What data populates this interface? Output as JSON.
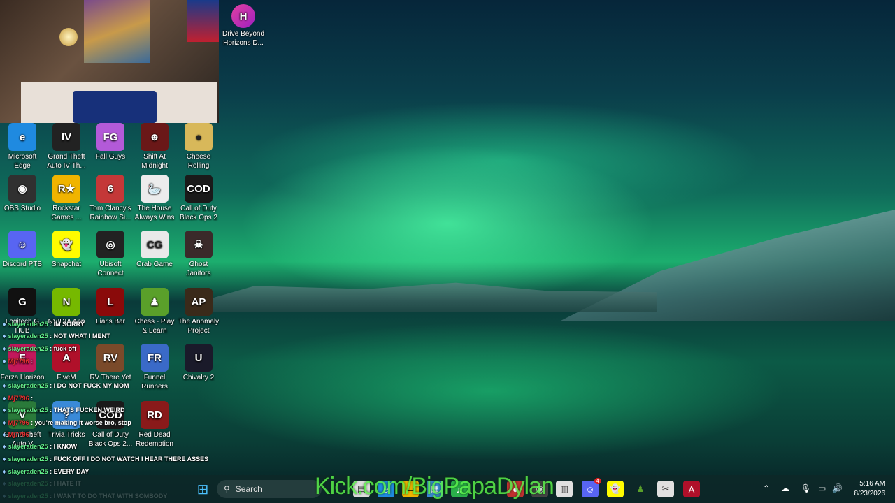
{
  "webcam": {
    "label": "streamer webcam"
  },
  "top_icon": {
    "label": "Drive Beyond Horizons D..."
  },
  "desktop_icons": [
    {
      "label": "Microsoft Edge",
      "glyph": "e",
      "color": "#1f8ae0"
    },
    {
      "label": "Grand Theft Auto IV Th...",
      "glyph": "IV",
      "color": "#222"
    },
    {
      "label": "Fall Guys",
      "glyph": "FG",
      "color": "#b35ad8"
    },
    {
      "label": "Shift At Midnight",
      "glyph": "☻",
      "color": "#6a1818"
    },
    {
      "label": "Cheese Rolling",
      "glyph": "●",
      "color": "#d8b85a"
    },
    {
      "label": "OBS Studio",
      "glyph": "◉",
      "color": "#303030"
    },
    {
      "label": "Rockstar Games ...",
      "glyph": "R★",
      "color": "#f0b400"
    },
    {
      "label": "Tom Clancy's Rainbow Si...",
      "glyph": "6",
      "color": "#c43838"
    },
    {
      "label": "The House Always Wins",
      "glyph": "🦢",
      "color": "#ececec"
    },
    {
      "label": "Call of Duty Black Ops 2",
      "glyph": "COD",
      "color": "#1a1a1a"
    },
    {
      "label": "Discord PTB",
      "glyph": "☺",
      "color": "#5865f2"
    },
    {
      "label": "Snapchat",
      "glyph": "👻",
      "color": "#fffc00"
    },
    {
      "label": "Ubisoft Connect",
      "glyph": "◎",
      "color": "#222"
    },
    {
      "label": "Crab Game",
      "glyph": "CG",
      "color": "#e9e9e9"
    },
    {
      "label": "Ghost Janitors",
      "glyph": "☠",
      "color": "#3a2a2a"
    },
    {
      "label": "Logitech G HUB",
      "glyph": "G",
      "color": "#111"
    },
    {
      "label": "NVIDIA App",
      "glyph": "N",
      "color": "#76b900"
    },
    {
      "label": "Liar's Bar",
      "glyph": "L",
      "color": "#8a0a0a"
    },
    {
      "label": "Chess - Play & Learn",
      "glyph": "♟",
      "color": "#5aa02a"
    },
    {
      "label": "The Anomaly Project",
      "glyph": "AP",
      "color": "#3a2a1a"
    },
    {
      "label": "Forza Horizon 5",
      "glyph": "F",
      "color": "#c2185b"
    },
    {
      "label": "FiveM",
      "glyph": "A",
      "color": "#b0102a"
    },
    {
      "label": "RV There Yet",
      "glyph": "RV",
      "color": "#7a4a2a"
    },
    {
      "label": "Funnel Runners",
      "glyph": "FR",
      "color": "#3a6ac8"
    },
    {
      "label": "Chivalry 2",
      "glyph": "U",
      "color": "#1a1a2a"
    },
    {
      "label": "Grand Theft Auto V",
      "glyph": "V",
      "color": "#2a7a3a"
    },
    {
      "label": "Trivia Tricks",
      "glyph": "?",
      "color": "#3a8ad8"
    },
    {
      "label": "Call of Duty Black Ops 2...",
      "glyph": "COD",
      "color": "#1a1a1a"
    },
    {
      "label": "Red Dead Redemption",
      "glyph": "RD",
      "color": "#8a1a1a"
    }
  ],
  "chat": [
    {
      "user": "slayeraden25",
      "msg": ": IM SORRY",
      "alt": false
    },
    {
      "user": "slayeraden25",
      "msg": ": NOT WHAT I MENT",
      "alt": false
    },
    {
      "user": "slayeraden25",
      "msg": ": fuck off",
      "alt": false
    },
    {
      "user": "Mj7796",
      "msg": ":",
      "alt": true
    },
    {
      "user": "slayeraden25",
      "msg": ": I DO NOT FUCK MY MOM",
      "alt": false
    },
    {
      "user": "Mj7796",
      "msg": ":",
      "alt": true
    },
    {
      "user": "slayeraden25",
      "msg": ": THATS FUCKEN WEIRD",
      "alt": false
    },
    {
      "user": "Mj7796",
      "msg": ": you're making it worse bro, stop",
      "alt": true
    },
    {
      "user": "Mj7796",
      "msg": ":",
      "alt": true
    },
    {
      "user": "slayeraden25",
      "msg": ": I KNOW",
      "alt": false
    },
    {
      "user": "slayeraden25",
      "msg": ": FUCK OFF I DO NOT WATCH I HEAR THERE ASSES",
      "alt": false
    },
    {
      "user": "slayeraden25",
      "msg": ": EVERY DAY",
      "alt": false
    },
    {
      "user": "slayeraden25",
      "msg": ": I HATE IT",
      "alt": false
    },
    {
      "user": "slayeraden25",
      "msg": ": I WANT TO DO THAT WITH SOMBODY",
      "alt": false
    }
  ],
  "taskbar": {
    "search_placeholder": "Search",
    "watermark": "Kick.com/BigPapaDylan",
    "clock_time": "5:16 AM",
    "clock_date": "8/23/2026",
    "discord_badge": "4"
  }
}
